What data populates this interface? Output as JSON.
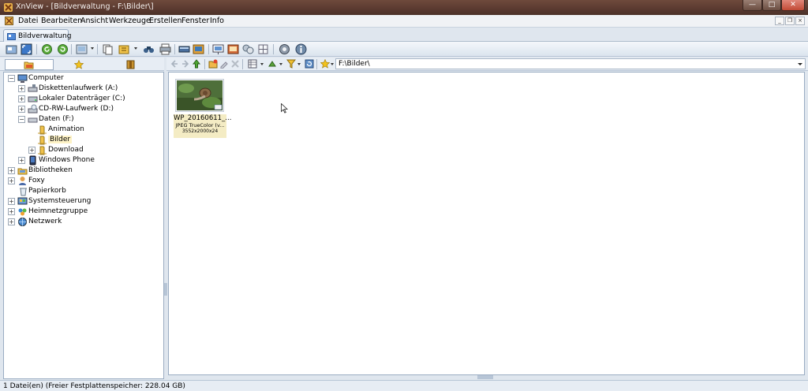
{
  "window": {
    "title": "XnView - [Bildverwaltung - F:\\Bilder\\]",
    "min_symbol": "—",
    "max_symbol": "□",
    "close_symbol": "✕"
  },
  "menu": {
    "items": [
      "Datei",
      "Bearbeiten",
      "Ansicht",
      "Werkzeuge",
      "Erstellen",
      "Fenster",
      "Info"
    ],
    "mdi": [
      "_",
      "❐",
      "×"
    ]
  },
  "tab": {
    "label": "Bildverwaltung"
  },
  "address": {
    "value": "F:\\Bilder\\"
  },
  "tree": {
    "computer": "Computer",
    "floppy": "Diskettenlaufwerk (A:)",
    "local_disk": "Lokaler Datenträger (C:)",
    "cdrw": "CD-RW-Laufwerk (D:)",
    "data": "Daten (F:)",
    "animation": "Animation",
    "bilder": "Bilder",
    "download": "Download",
    "windows_phone": "Windows Phone",
    "libraries": "Bibliotheken",
    "foxy": "Foxy",
    "recycle": "Papierkorb",
    "control_panel": "Systemsteuerung",
    "homegroup": "Heimnetzgruppe",
    "network": "Netzwerk"
  },
  "thumbnail": {
    "filename": "WP_20160611_...",
    "type": "JPEG TrueColor (v...",
    "dims": "3552x2000x24"
  },
  "status": {
    "text": "1 Datei(en) (Freier Festplattenspeicher: 228.04 GB)"
  },
  "colors": {
    "title_bg": "#5a3a30",
    "selection": "#fdf2c6",
    "caption_bg": "#f4ecc4",
    "panel": "#dfe6ee"
  },
  "icons": [
    "xnview-app-icon",
    "fullscreen-icon",
    "rotate-left-icon",
    "rotate-right-icon",
    "slideshow-icon",
    "print-icon",
    "binoculars-icon",
    "scanner-icon",
    "settings-gear-icon",
    "info-icon",
    "back-arrow-icon",
    "forward-arrow-icon",
    "up-folder-icon",
    "star-favorite-icon",
    "refresh-icon",
    "folder-icon",
    "computer-icon",
    "floppy-drive-icon",
    "hard-drive-icon",
    "cd-drive-icon",
    "phone-icon",
    "recycle-bin-icon",
    "network-icon"
  ]
}
